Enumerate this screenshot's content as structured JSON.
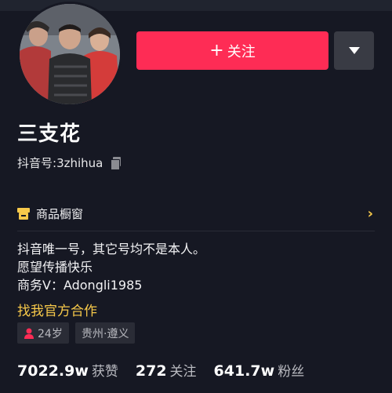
{
  "profile": {
    "name": "三支花",
    "douyin_id_label": "抖音号:",
    "douyin_id": "3zhihua",
    "follow_label": "关注",
    "follow_plus": "+"
  },
  "shop": {
    "label": "商品橱窗"
  },
  "bio": {
    "lines": [
      "抖音唯一号，其它号均不是本人。",
      "愿望传播快乐",
      "商务V：Adongli1985"
    ],
    "link": "找我官方合作"
  },
  "tags": {
    "age": "24岁",
    "location": "贵州·遵义"
  },
  "stats": {
    "likes_value": "7022.9w",
    "likes_label": "获赞",
    "following_value": "272",
    "following_label": "关注",
    "followers_value": "641.7w",
    "followers_label": "粉丝"
  },
  "colors": {
    "accent": "#fe2c55",
    "link": "#f7c94a",
    "background": "#161823"
  },
  "icons": {
    "follow": "plus-icon",
    "more": "triangle-down-icon",
    "copy": "copy-icon",
    "shop": "shop-icon",
    "chevron": "chevron-right-icon",
    "gender": "female-icon"
  }
}
